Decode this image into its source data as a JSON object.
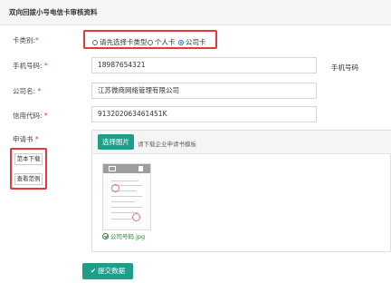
{
  "page": {
    "title": "双向回拨小号电信卡审核资料"
  },
  "form": {
    "card_type": {
      "label": "卡类别:",
      "required_mark": "*",
      "options": [
        {
          "label": "请先选择卡类型",
          "selected": false
        },
        {
          "label": "个人卡",
          "selected": false
        },
        {
          "label": "公司卡",
          "selected": true
        }
      ]
    },
    "phone": {
      "label": "手机号码:",
      "required_mark": "*",
      "value": "18987654321",
      "side_note": "手机号码"
    },
    "company": {
      "label": "公司名:",
      "required_mark": "*",
      "value": "江苏微商网络管理有限公司"
    },
    "credit_code": {
      "label": "信用代码:",
      "required_mark": "*",
      "value": "913202063461451K"
    },
    "application": {
      "label": "申请书",
      "required_mark": "*",
      "select_button": "选择图片",
      "hint": "请下载企业申请书模板",
      "file_name": "公司号码.jpg",
      "template_button": "范本下载",
      "example_button": "查看范例"
    }
  },
  "actions": {
    "submit_label": "提交数据"
  },
  "colors": {
    "accent": "#1e9e8a",
    "highlight": "#e53935",
    "success": "#2e7d32"
  }
}
